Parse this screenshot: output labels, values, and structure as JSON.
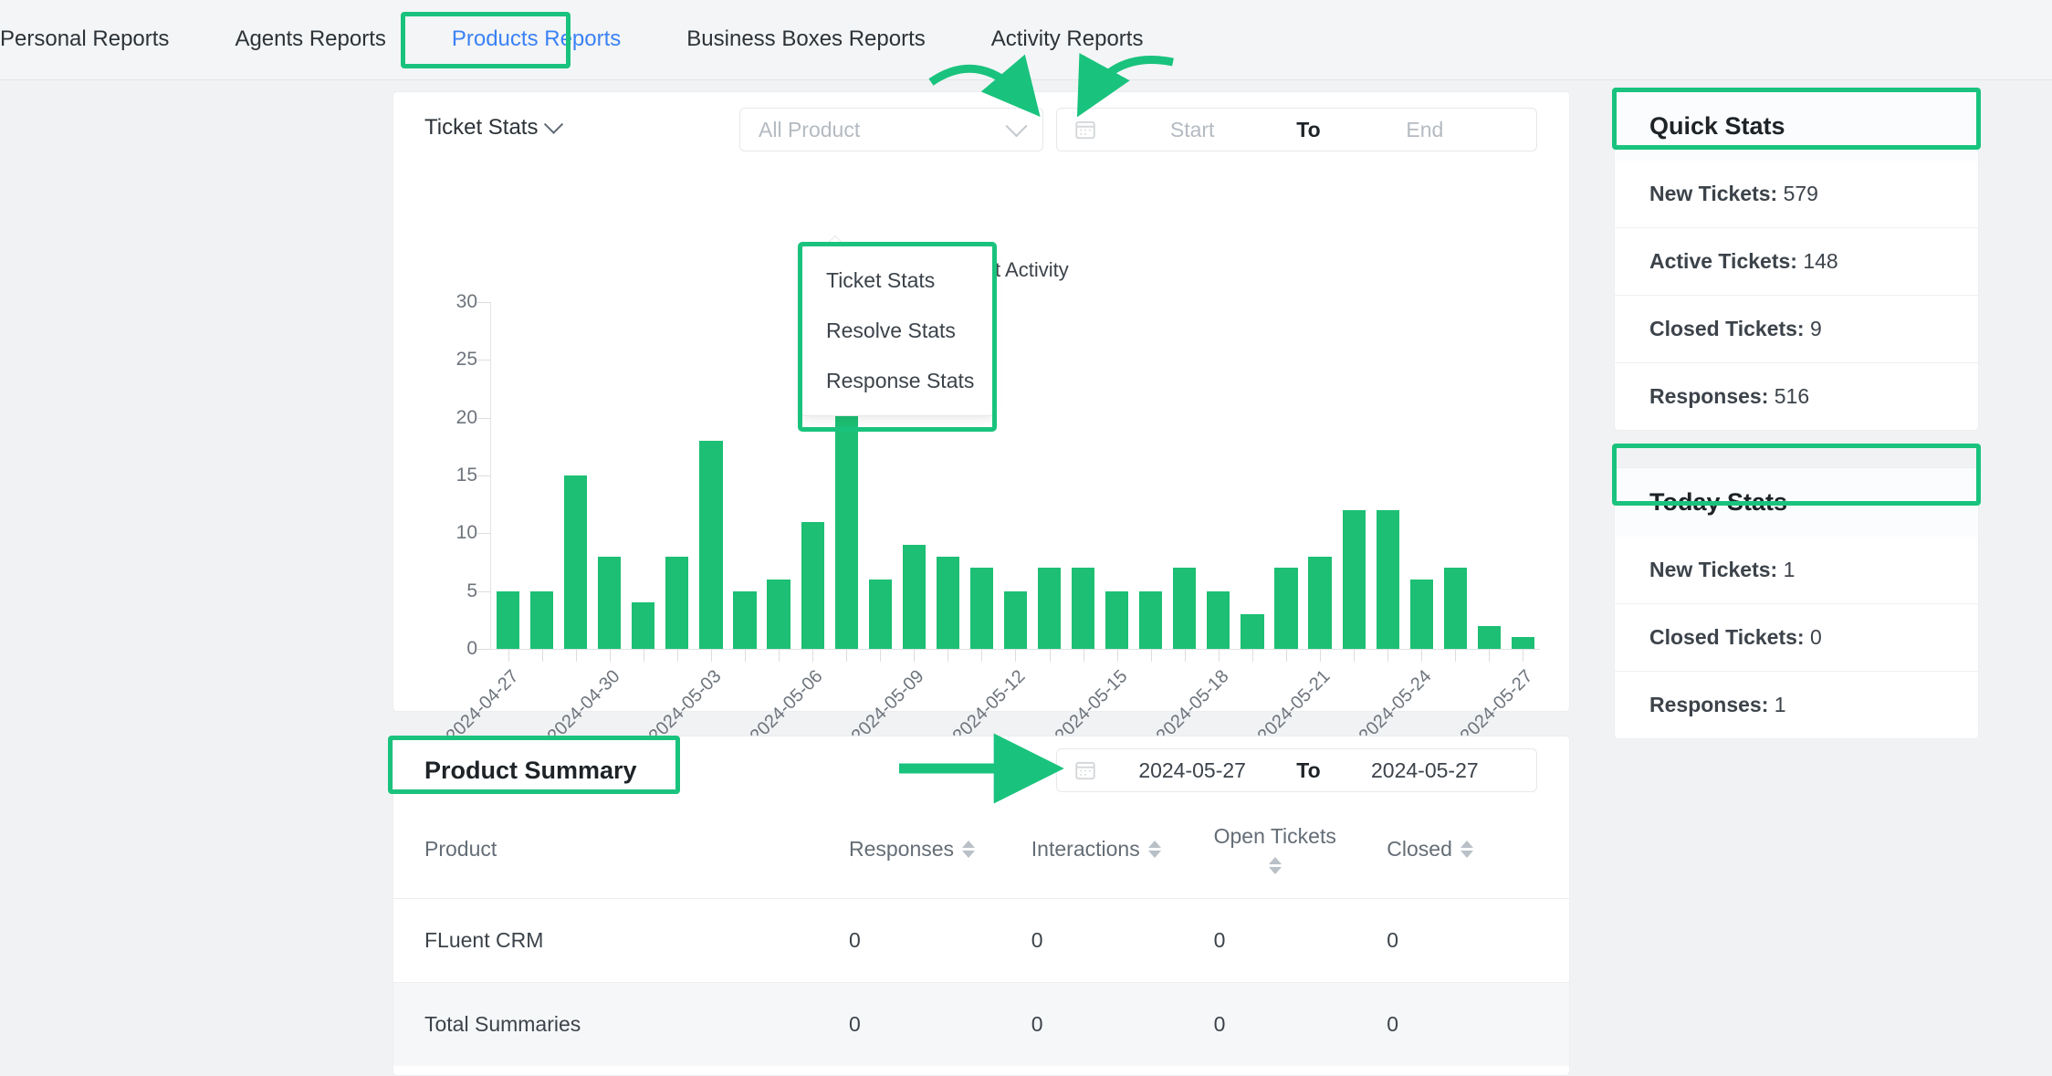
{
  "nav": {
    "tabs": [
      {
        "label": "Personal Reports",
        "active": false
      },
      {
        "label": "Agents Reports",
        "active": false
      },
      {
        "label": "Products Reports",
        "active": true
      },
      {
        "label": "Business Boxes Reports",
        "active": false
      },
      {
        "label": "Activity Reports",
        "active": false
      }
    ]
  },
  "toolbar": {
    "stats_selected": "Ticket Stats",
    "stats_options": [
      "Ticket Stats",
      "Resolve Stats",
      "Response Stats"
    ],
    "product_placeholder": "All Product",
    "date_start_placeholder": "Start",
    "date_to_label": "To",
    "date_end_placeholder": "End",
    "calendar_icon": "calendar-icon",
    "chevron_icon": "chevron-down-icon"
  },
  "summary": {
    "title": "Product Summary",
    "date_start": "2024-05-27",
    "date_to_label": "To",
    "date_end": "2024-05-27",
    "columns": [
      "Product",
      "Responses",
      "Interactions",
      "Open Tickets",
      "Closed"
    ],
    "rows": [
      {
        "product": "FLuent CRM",
        "responses": "0",
        "interactions": "0",
        "open": "0",
        "closed": "0"
      },
      {
        "product": "Total Summaries",
        "responses": "0",
        "interactions": "0",
        "open": "0",
        "closed": "0"
      }
    ]
  },
  "sidebar": {
    "quick": {
      "title": "Quick Stats",
      "rows": [
        {
          "label": "New Tickets:",
          "value": "579"
        },
        {
          "label": "Active Tickets:",
          "value": "148"
        },
        {
          "label": "Closed Tickets:",
          "value": "9"
        },
        {
          "label": "Responses:",
          "value": "516"
        }
      ]
    },
    "today": {
      "title": "Today Stats",
      "rows": [
        {
          "label": "New Tickets:",
          "value": "1"
        },
        {
          "label": "Closed Tickets:",
          "value": "0"
        },
        {
          "label": "Responses:",
          "value": "1"
        }
      ]
    }
  },
  "colors": {
    "accent_green": "#19c37d",
    "bar_green": "#1cbf73",
    "active_tab_blue": "#3b82f6"
  },
  "chart_data": {
    "type": "bar",
    "title": "",
    "legend": [
      "Ticket Activity"
    ],
    "legend_position": "top-center",
    "xlabel": "",
    "ylabel": "",
    "ylim": [
      0,
      30
    ],
    "yticks": [
      0,
      5,
      10,
      15,
      20,
      25,
      30
    ],
    "grid": false,
    "x": [
      "2024-04-27",
      "2024-04-28",
      "2024-04-29",
      "2024-04-30",
      "2024-05-01",
      "2024-05-02",
      "2024-05-03",
      "2024-05-04",
      "2024-05-05",
      "2024-05-06",
      "2024-05-07",
      "2024-05-08",
      "2024-05-09",
      "2024-05-10",
      "2024-05-11",
      "2024-05-12",
      "2024-05-13",
      "2024-05-14",
      "2024-05-15",
      "2024-05-16",
      "2024-05-17",
      "2024-05-18",
      "2024-05-19",
      "2024-05-20",
      "2024-05-21",
      "2024-05-22",
      "2024-05-23",
      "2024-05-24",
      "2024-05-25",
      "2024-05-26",
      "2024-05-27"
    ],
    "xtick_labels": [
      "2024-04-27",
      "2024-04-30",
      "2024-05-03",
      "2024-05-06",
      "2024-05-09",
      "2024-05-12",
      "2024-05-15",
      "2024-05-18",
      "2024-05-21",
      "2024-05-24",
      "2024-05-27"
    ],
    "xtick_every": 3,
    "series": [
      {
        "name": "Ticket Activity",
        "color": "#1cbf73",
        "values": [
          5,
          5,
          15,
          8,
          4,
          8,
          18,
          5,
          6,
          11,
          50,
          6,
          9,
          8,
          7,
          5,
          7,
          7,
          5,
          5,
          7,
          5,
          3,
          7,
          8,
          12,
          12,
          6,
          7,
          2,
          1
        ]
      }
    ]
  }
}
